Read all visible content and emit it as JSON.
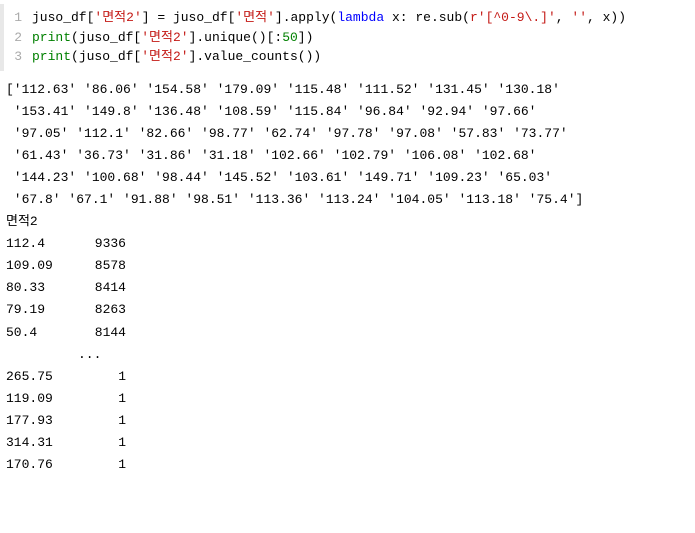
{
  "code": {
    "lines": [
      {
        "num": "1",
        "tokens": [
          {
            "t": "juso_df[",
            "c": "s-ident"
          },
          {
            "t": "'면적2'",
            "c": "s-str"
          },
          {
            "t": "] = juso_df[",
            "c": "s-ident"
          },
          {
            "t": "'면적'",
            "c": "s-str"
          },
          {
            "t": "].apply(",
            "c": "s-ident"
          },
          {
            "t": "lambda",
            "c": "s-kw"
          },
          {
            "t": " x: re.sub(",
            "c": "s-ident"
          },
          {
            "t": "r'[^0-9\\.]'",
            "c": "s-rawpre"
          },
          {
            "t": ", ",
            "c": "s-ident"
          },
          {
            "t": "''",
            "c": "s-str"
          },
          {
            "t": ", x))",
            "c": "s-ident"
          }
        ]
      },
      {
        "num": "2",
        "tokens": [
          {
            "t": "print",
            "c": "s-builtin"
          },
          {
            "t": "(juso_df[",
            "c": "s-ident"
          },
          {
            "t": "'면적2'",
            "c": "s-str"
          },
          {
            "t": "].unique()[:",
            "c": "s-ident"
          },
          {
            "t": "50",
            "c": "s-num"
          },
          {
            "t": "])",
            "c": "s-ident"
          }
        ]
      },
      {
        "num": "3",
        "tokens": [
          {
            "t": "print",
            "c": "s-builtin"
          },
          {
            "t": "(juso_df[",
            "c": "s-ident"
          },
          {
            "t": "'면적2'",
            "c": "s-str"
          },
          {
            "t": "].value_counts())",
            "c": "s-ident"
          }
        ]
      }
    ]
  },
  "output": {
    "array_lines": [
      "['112.63' '86.06' '154.58' '179.09' '115.48' '111.52' '131.45' '130.18'",
      " '153.41' '149.8' '136.48' '108.59' '115.84' '96.84' '92.94' '97.66'",
      " '97.05' '112.1' '82.66' '98.77' '62.74' '97.78' '97.08' '57.83' '73.77'",
      " '61.43' '36.73' '31.86' '31.18' '102.66' '102.79' '106.08' '102.68'",
      " '144.23' '100.68' '98.44' '145.52' '103.61' '149.71' '109.23' '65.03'",
      " '67.8' '67.1' '91.88' '98.51' '113.36' '113.24' '104.05' '113.18' '75.4']"
    ],
    "vc_header": "면적2",
    "vc_top": [
      {
        "k": "112.4",
        "v": "9336"
      },
      {
        "k": "109.09",
        "v": "8578"
      },
      {
        "k": "80.33",
        "v": "8414"
      },
      {
        "k": "79.19",
        "v": "8263"
      },
      {
        "k": "50.4",
        "v": "8144"
      }
    ],
    "vc_ellipsis": "... ",
    "vc_bottom": [
      {
        "k": "265.75",
        "v": "1"
      },
      {
        "k": "119.09",
        "v": "1"
      },
      {
        "k": "177.93",
        "v": "1"
      },
      {
        "k": "314.31",
        "v": "1"
      },
      {
        "k": "170.76",
        "v": "1"
      }
    ]
  }
}
